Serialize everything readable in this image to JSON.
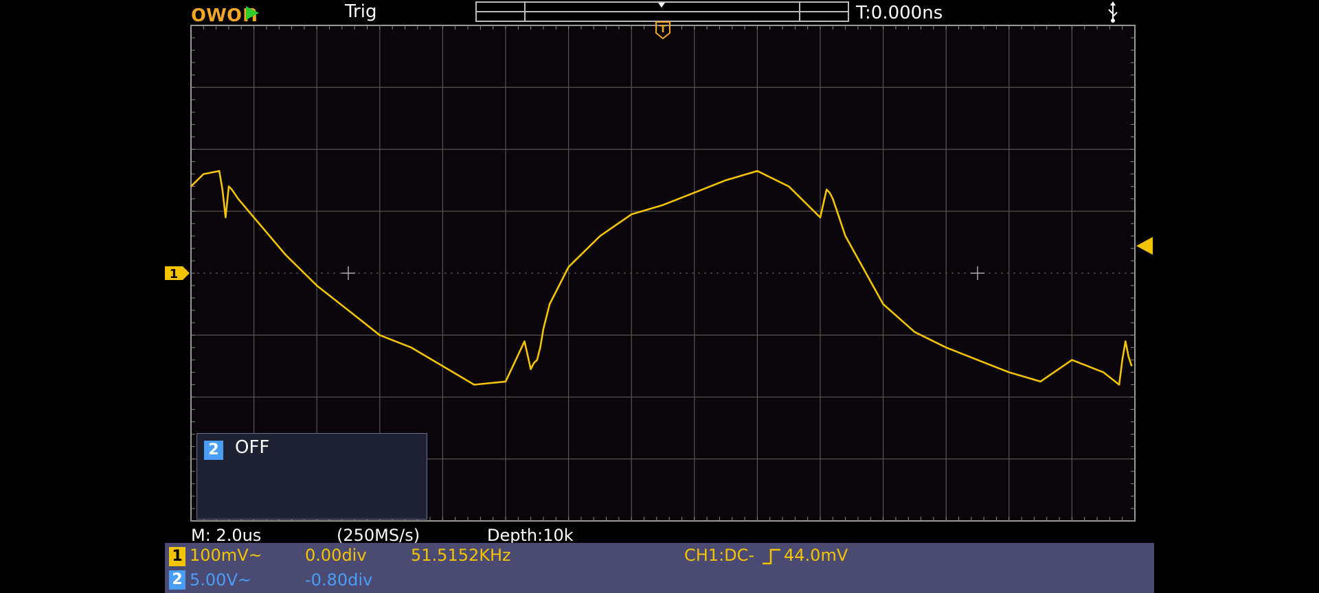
{
  "header": {
    "logo": "owon",
    "run_state": "running",
    "trigger_status": "Trig",
    "trigger_time": "T:0.000ns",
    "usb_icon": "usb-icon"
  },
  "grid": {
    "h_divisions": 15,
    "v_divisions": 8
  },
  "channel_popup": {
    "channel": "2",
    "state": "OFF"
  },
  "acquisition": {
    "timebase": "M: 2.0us",
    "sample_rate": "(250MS/s)",
    "depth": "Depth:10k"
  },
  "channels": [
    {
      "badge": "1",
      "scale": "100mV~",
      "offset": "0.00div",
      "frequency": "51.5152KHz",
      "color": "#f5c400"
    },
    {
      "badge": "2",
      "scale": "5.00V~",
      "offset": "-0.80div",
      "color": "#4a9ef5"
    }
  ],
  "trigger": {
    "source_coupling": "CH1:DC-",
    "edge": "rising",
    "level": "44.0mV"
  },
  "chart_data": {
    "type": "line",
    "series": [
      {
        "color": "#f5c400",
        "x_div": [
          0,
          0.2,
          0.45,
          0.5,
          0.55,
          0.6,
          0.65,
          0.75,
          1.0,
          1.5,
          2.0,
          2.5,
          3.0,
          3.5,
          4.0,
          4.5,
          5.0,
          5.3,
          5.4,
          5.45,
          5.5,
          5.55,
          5.6,
          5.7,
          6.0,
          6.5,
          7.0,
          7.5,
          8.0,
          8.5,
          9.0,
          9.5,
          10.0,
          10.1,
          10.15,
          10.2,
          10.25,
          10.3,
          10.4,
          10.7,
          11.0,
          11.5,
          12.0,
          12.5,
          13.0,
          13.5,
          14.0,
          14.5,
          14.75,
          14.8,
          14.85,
          14.9,
          14.95
        ],
        "y_div": [
          1.4,
          1.6,
          1.65,
          1.35,
          0.9,
          1.4,
          1.35,
          1.2,
          0.9,
          0.3,
          -0.2,
          -0.6,
          -1.0,
          -1.2,
          -1.5,
          -1.8,
          -1.75,
          -1.1,
          -1.55,
          -1.45,
          -1.4,
          -1.2,
          -0.9,
          -0.5,
          0.1,
          0.6,
          0.95,
          1.1,
          1.3,
          1.5,
          1.65,
          1.4,
          0.9,
          1.35,
          1.3,
          1.2,
          1.05,
          0.9,
          0.6,
          0.05,
          -0.5,
          -0.95,
          -1.2,
          -1.4,
          -1.6,
          -1.75,
          -1.4,
          -1.6,
          -1.8,
          -1.4,
          -1.1,
          -1.35,
          -1.5
        ]
      }
    ]
  }
}
